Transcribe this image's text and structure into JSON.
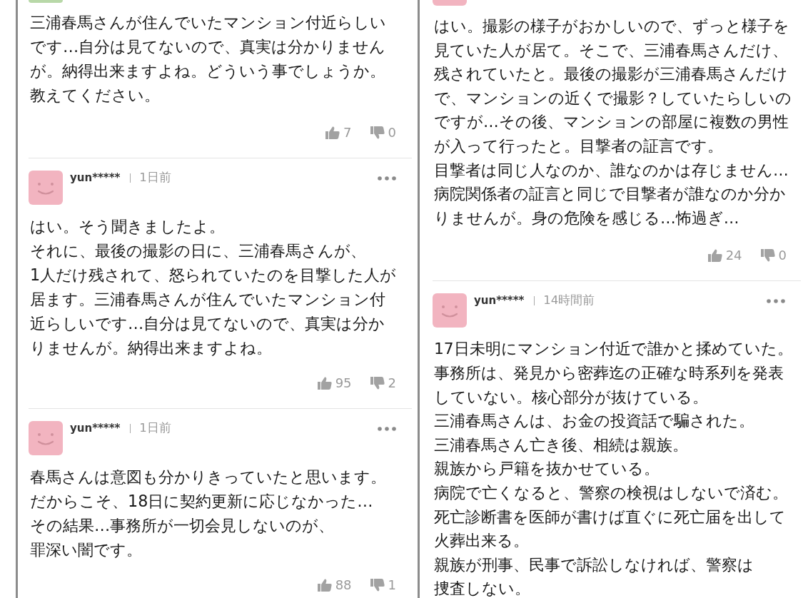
{
  "columns": [
    {
      "comments": [
        {
          "kind": "continued",
          "color": "#b8d8a8",
          "lines": [
            "三浦春馬さんが住んでいたマンション付近らしい",
            "です…自分は見てないので、真実は分かりません",
            "が。納得出来ますよね。どういう事でしょうか。",
            "教えてください。"
          ],
          "likes": "7",
          "dislikes": "0"
        },
        {
          "kind": "full",
          "color": "#f2b4c0",
          "user": "yun*****",
          "time": "1日前",
          "lines": [
            "はい。そう聞きましたよ。",
            "それに、最後の撮影の日に、三浦春馬さんが、",
            "1人だけ残されて、怒られていたのを目撃した人が",
            "居ます。三浦春馬さんが住んでいたマンション付",
            "近らしいです…自分は見てないので、真実は分か",
            "りませんが。納得出来ますよね。"
          ],
          "likes": "95",
          "dislikes": "2"
        },
        {
          "kind": "full",
          "color": "#f2b4c0",
          "user": "yun*****",
          "time": "1日前",
          "lines": [
            "春馬さんは意図も分かりきっていたと思います。",
            "だからこそ、18日に契約更新に応じなかった…",
            "その結果…事務所が一切会見しないのが、",
            "罪深い闇です。"
          ],
          "likes": "88",
          "dislikes": "1"
        }
      ]
    },
    {
      "comments": [
        {
          "kind": "continued",
          "color": "#f2b4c0",
          "lines": [
            "はい。撮影の様子がおかしいので、ずっと様子を",
            "見ていた人が居て。そこで、三浦春馬さんだけ、",
            "残されていたと。最後の撮影が三浦春馬さんだけ",
            "で、マンションの近くで撮影？していたらしいの",
            "ですが…その後、マンションの部屋に複数の男性",
            "が入って行ったと。目撃者の証言です。",
            "目撃者は同じ人なのか、誰なのかは存じません…",
            "病院関係者の証言と同じで目撃者が誰なのか分か",
            "りませんが。身の危険を感じる…怖過ぎ…"
          ],
          "likes": "24",
          "dislikes": "0"
        },
        {
          "kind": "full",
          "color": "#f2b4c0",
          "user": "yun*****",
          "time": "14時間前",
          "lines": [
            "17日未明にマンション付近で誰かと揉めていた。",
            "事務所は、発見から密葬迄の正確な時系列を発表",
            "していない。核心部分が抜けている。",
            "三浦春馬さんは、お金の投資話で騙された。",
            "三浦春馬さん亡き後、相続は親族。",
            "親族から戸籍を抜かせている。",
            "病院で亡くなると、警察の検視はしないで済む。",
            "死亡診断書を医師が書けば直ぐに死亡届を出して",
            "火葬出来る。",
            "親族が刑事、民事で訴訟しなければ、警察は",
            "捜査しない。"
          ]
        }
      ]
    }
  ]
}
